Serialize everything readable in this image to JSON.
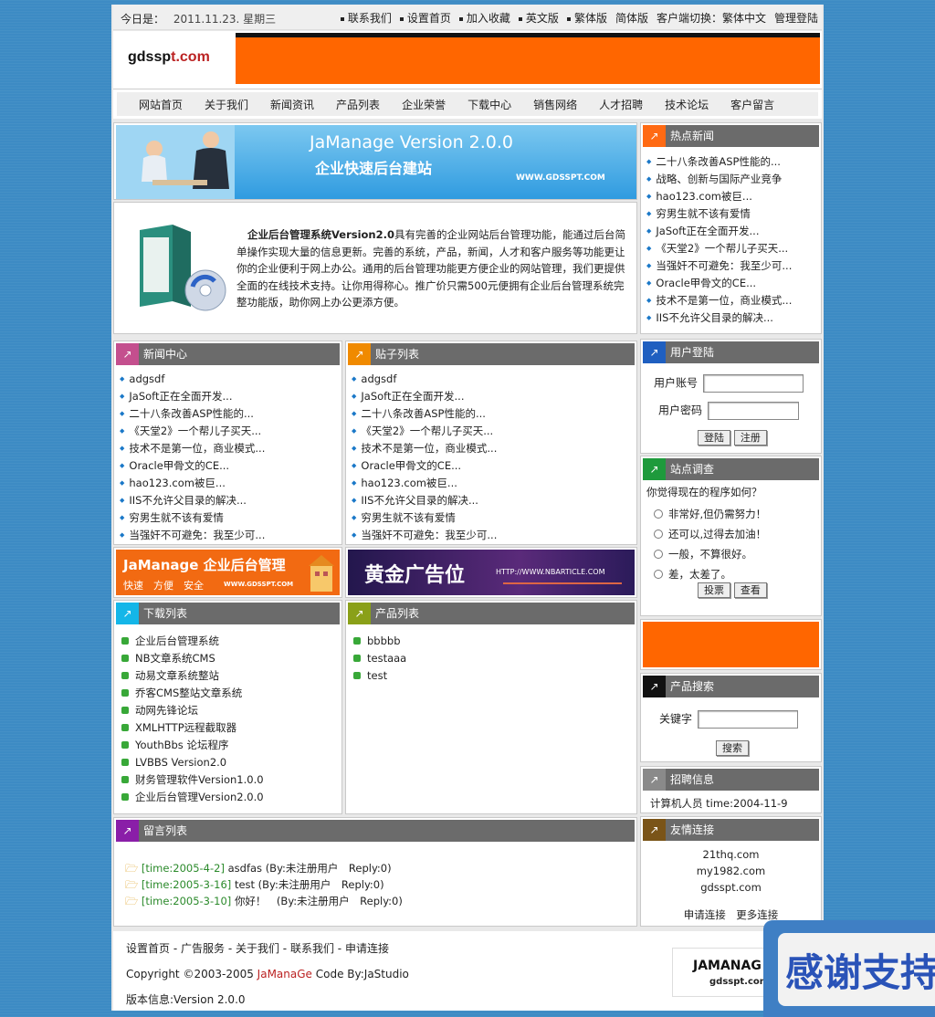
{
  "topbar": {
    "today_label": "今日是：",
    "date": "2011.11.23. 星期三",
    "links": [
      "联系我们",
      "设置首页",
      "加入收藏",
      "英文版",
      "繁体版",
      "简体版"
    ],
    "client_switch": "客户端切换：繁体中文",
    "admin": "管理登陆"
  },
  "logo": {
    "main": "gdssp",
    "tail": "t.com"
  },
  "nav": [
    "网站首页",
    "关于我们",
    "新闻资讯",
    "产品列表",
    "企业荣誉",
    "下载中心",
    "销售网络",
    "人才招聘",
    "技术论坛",
    "客户留言"
  ],
  "banner": {
    "title": "JaManage Version 2.0.0",
    "subtitle": "企业快速后台建站",
    "url": "WWW.GDSSPT.COM"
  },
  "intro": {
    "bold": "企业后台管理系统Version2.0",
    "text": "具有完善的企业网站后台管理功能，能通过后台简单操作实现大量的信息更新。完善的系统，产品，新闻，人才和客户服务等功能更让你的企业便利于网上办公。通用的后台管理功能更方便企业的网站管理，我们更提供全面的在线技术支持。让你用得称心。推广价只需500元便拥有企业后台管理系统完整功能版，助你网上办公更添方便。"
  },
  "hot_news": {
    "title": "热点新闻",
    "items": [
      "二十八条改善ASP性能的...",
      "战略、创新与国际产业竞争",
      "hao123.com被巨...",
      "穷男生就不该有爱情",
      "JaSoft正在全面开发...",
      "《天堂2》一个帮儿子买天...",
      "当强奸不可避免：我至少可...",
      "Oracle甲骨文的CE...",
      "技术不是第一位，商业模式...",
      "IIS不允许父目录的解决..."
    ]
  },
  "news_center": {
    "title": "新闻中心",
    "items": [
      "adgsdf",
      "JaSoft正在全面开发...",
      "二十八条改善ASP性能的...",
      "《天堂2》一个帮儿子买天...",
      "技术不是第一位，商业模式...",
      "Oracle甲骨文的CE...",
      "hao123.com被巨...",
      "IIS不允许父目录的解决...",
      "穷男生就不该有爱情",
      "当强奸不可避免：我至少可..."
    ]
  },
  "post_list": {
    "title": "贴子列表",
    "items": [
      "adgsdf",
      "JaSoft正在全面开发...",
      "二十八条改善ASP性能的...",
      "《天堂2》一个帮儿子买天...",
      "技术不是第一位，商业模式...",
      "Oracle甲骨文的CE...",
      "hao123.com被巨...",
      "IIS不允许父目录的解决...",
      "穷男生就不该有爱情",
      "当强奸不可避免：我至少可..."
    ]
  },
  "ads": {
    "left_title": "JaManage 企业后台管理",
    "left_sub": "快速　方便　安全",
    "left_url": "WWW.GDSSPT.COM",
    "right_title": "黄金广告位",
    "right_url": "HTTP://WWW.NBARTICLE.COM"
  },
  "download": {
    "title": "下载列表",
    "items": [
      "企业后台管理系统",
      "NB文章系统CMS",
      "动易文章系统整站",
      "乔客CMS整站文章系统",
      "动网先锋论坛",
      "XMLHTTP远程截取器",
      "YouthBbs 论坛程序",
      "LVBBS Version2.0",
      "财务管理软件Version1.0.0",
      "企业后台管理Version2.0.0"
    ]
  },
  "products": {
    "title": "产品列表",
    "items": [
      "bbbbb",
      "testaaa",
      "test"
    ]
  },
  "guestbook": {
    "title": "留言列表",
    "items": [
      {
        "time": "[time:2005-4-2]",
        "text": "asdfas (By:未注册用户　Reply:0)"
      },
      {
        "time": "[time:2005-3-16]",
        "text": "test (By:未注册用户　Reply:0)"
      },
      {
        "time": "[time:2005-3-10]",
        "text": "你好！　(By:未注册用户　Reply:0)"
      }
    ]
  },
  "login": {
    "title": "用户登陆",
    "user_label": "用户账号",
    "pass_label": "用户密码",
    "login_btn": "登陆",
    "register_btn": "注册"
  },
  "survey": {
    "title": "站点调查",
    "question": "你觉得现在的程序如何？",
    "options": [
      "非常好,但仍需努力！",
      "还可以,过得去加油！",
      "一般，不算很好。",
      "差，太差了。"
    ],
    "vote_btn": "投票",
    "view_btn": "查看"
  },
  "product_search": {
    "title": "产品搜索",
    "keyword_label": "关键字",
    "search_btn": "搜索"
  },
  "jobs": {
    "title": "招聘信息",
    "item": "计算机人员 time:2004-11-9"
  },
  "friend_links": {
    "title": "友情连接",
    "items": [
      "21thq.com",
      "my1982.com",
      "gdsspt.com"
    ],
    "apply": "申请连接",
    "more": "更多连接"
  },
  "footer": {
    "links": [
      "设置首页",
      "广告服务",
      "关于我们",
      "联系我们",
      "申请连接"
    ],
    "copyright_pre": "Copyright ©2003-2005 ",
    "brand": "JaManaGe",
    "copyright_post": " Code By:JaStudio",
    "version": "版本信息:Version 2.0.0",
    "logo_main": "JAMANAG",
    "logo_sub": "gdsspt.com"
  },
  "floating": {
    "text": "感谢支持"
  },
  "colors": {
    "orange": "#ff6600",
    "bar": "#6b6b6b",
    "page_bg": "#3d8bc4"
  }
}
